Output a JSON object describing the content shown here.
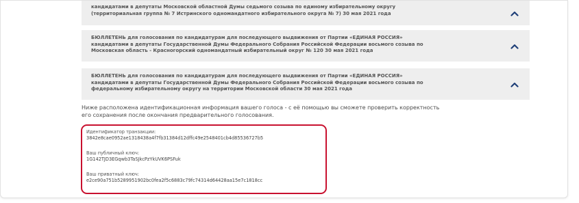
{
  "ballots": [
    {
      "text": "кандидатами в депутаты Московской областной Думы седьмого созыва по единому избирательному округу\n(территориальная группа № 7 Истринского одномандатного избирательного округа № 7) 30 мая 2021 года",
      "chevron": "chevron-up-icon"
    },
    {
      "text": "БЮЛЛЕТЕНЬ для голосования по кандидатурам для последующего выдвижения от Партии «ЕДИНАЯ РОССИЯ»\nкандидатами в депутаты Государственной Думы Федерального Собрания Российской Федерации восьмого созыва по\nМосковская область - Красногорский одномандатный избирательный округ № 120 30 мая 2021 года",
      "chevron": "chevron-up-icon"
    },
    {
      "text": "БЮЛЛЕТЕНЬ для голосования по кандидатурам для последующего выдвижения от Партии «ЕДИНАЯ РОССИЯ»\nкандидатами в депутаты Государственной Думы Федерального Собрания Российской Федерации восьмого созыва по\nфедеральному избирательному округу на территории Московской области 30 мая 2021 года",
      "chevron": "chevron-up-icon"
    }
  ],
  "info_text": "Ниже расположена идентификационная информация вашего голоса - с её помощью вы сможете проверить корректность\nего сохранения после окончания предварительного голосования.",
  "identification": {
    "transaction_id_label": "Идентификатор транзакции:",
    "transaction_id_value": "3842e8cae0952ae1318438a4f7fb31384d12dffc49e2548401cb4d85536727b5",
    "public_key_label": "Ваш публичный ключ:",
    "public_key_value": "1G142TJD3EGqwb3TaSJkcPzYkUVK6PSFuk",
    "private_key_label": "Ваш приватный ключ:",
    "private_key_value": "e2ce90a751b5289951902bc0fea2f5c6883c79fc74314d64428aa15e7c1818cc"
  },
  "colors": {
    "highlight_border": "#c8102e",
    "ballot_background": "#eeeeee",
    "chevron": "#1f3f78"
  }
}
